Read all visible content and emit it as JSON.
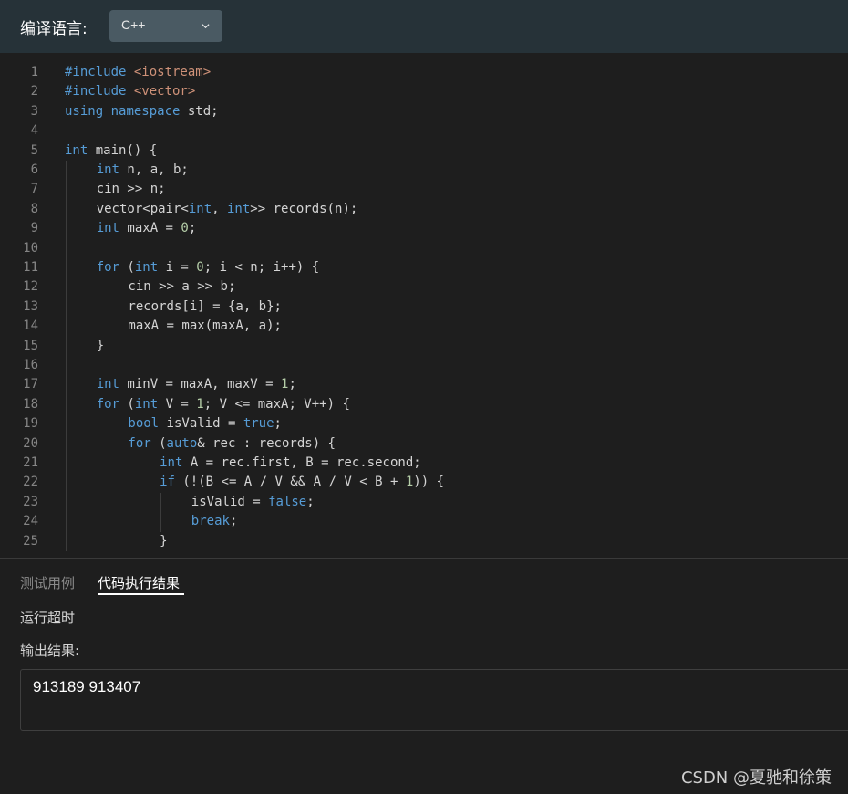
{
  "header": {
    "language_label": "编译语言:",
    "language_value": "C++"
  },
  "code_lines": [
    {
      "n": "1",
      "indent": 0,
      "tokens": [
        [
          "pp",
          "#include "
        ],
        [
          "str",
          "<iostream>"
        ]
      ]
    },
    {
      "n": "2",
      "indent": 0,
      "tokens": [
        [
          "pp",
          "#include "
        ],
        [
          "str",
          "<vector>"
        ]
      ]
    },
    {
      "n": "3",
      "indent": 0,
      "tokens": [
        [
          "kw",
          "using"
        ],
        [
          "",
          " "
        ],
        [
          "kw",
          "namespace"
        ],
        [
          "",
          " std;"
        ]
      ]
    },
    {
      "n": "4",
      "indent": 0,
      "tokens": []
    },
    {
      "n": "5",
      "indent": 0,
      "tokens": [
        [
          "kw",
          "int"
        ],
        [
          "",
          " main() {"
        ]
      ]
    },
    {
      "n": "6",
      "indent": 1,
      "tokens": [
        [
          "kw",
          "int"
        ],
        [
          "",
          " n, a, b;"
        ]
      ]
    },
    {
      "n": "7",
      "indent": 1,
      "tokens": [
        [
          "",
          "cin >> n;"
        ]
      ]
    },
    {
      "n": "8",
      "indent": 1,
      "tokens": [
        [
          "",
          "vector<pair<"
        ],
        [
          "kw",
          "int"
        ],
        [
          "",
          ", "
        ],
        [
          "kw",
          "int"
        ],
        [
          "",
          ">> records(n);"
        ]
      ]
    },
    {
      "n": "9",
      "indent": 1,
      "tokens": [
        [
          "kw",
          "int"
        ],
        [
          "",
          " maxA = "
        ],
        [
          "num",
          "0"
        ],
        [
          "",
          ";"
        ]
      ]
    },
    {
      "n": "10",
      "indent": 1,
      "tokens": []
    },
    {
      "n": "11",
      "indent": 1,
      "tokens": [
        [
          "kw",
          "for"
        ],
        [
          "",
          " ("
        ],
        [
          "kw",
          "int"
        ],
        [
          "",
          " i = "
        ],
        [
          "num",
          "0"
        ],
        [
          "",
          "; i < n; i++) {"
        ]
      ]
    },
    {
      "n": "12",
      "indent": 2,
      "tokens": [
        [
          "",
          "cin >> a >> b;"
        ]
      ]
    },
    {
      "n": "13",
      "indent": 2,
      "tokens": [
        [
          "",
          "records[i] = {a, b};"
        ]
      ]
    },
    {
      "n": "14",
      "indent": 2,
      "tokens": [
        [
          "",
          "maxA = max(maxA, a);"
        ]
      ]
    },
    {
      "n": "15",
      "indent": 1,
      "tokens": [
        [
          "",
          "}"
        ]
      ]
    },
    {
      "n": "16",
      "indent": 1,
      "tokens": []
    },
    {
      "n": "17",
      "indent": 1,
      "tokens": [
        [
          "kw",
          "int"
        ],
        [
          "",
          " minV = maxA, maxV = "
        ],
        [
          "num",
          "1"
        ],
        [
          "",
          ";"
        ]
      ]
    },
    {
      "n": "18",
      "indent": 1,
      "tokens": [
        [
          "kw",
          "for"
        ],
        [
          "",
          " ("
        ],
        [
          "kw",
          "int"
        ],
        [
          "",
          " V = "
        ],
        [
          "num",
          "1"
        ],
        [
          "",
          "; V <= maxA; V++) {"
        ]
      ]
    },
    {
      "n": "19",
      "indent": 2,
      "tokens": [
        [
          "kw",
          "bool"
        ],
        [
          "",
          " isValid = "
        ],
        [
          "kw",
          "true"
        ],
        [
          "",
          ";"
        ]
      ]
    },
    {
      "n": "20",
      "indent": 2,
      "tokens": [
        [
          "kw",
          "for"
        ],
        [
          "",
          " ("
        ],
        [
          "kw",
          "auto"
        ],
        [
          "",
          "& rec : records) {"
        ]
      ]
    },
    {
      "n": "21",
      "indent": 3,
      "tokens": [
        [
          "kw",
          "int"
        ],
        [
          "",
          " A = rec.first, B = rec.second;"
        ]
      ]
    },
    {
      "n": "22",
      "indent": 3,
      "tokens": [
        [
          "kw",
          "if"
        ],
        [
          "",
          " (!(B <= A / V && A / V < B + "
        ],
        [
          "num",
          "1"
        ],
        [
          "",
          ")) {"
        ]
      ]
    },
    {
      "n": "23",
      "indent": 4,
      "tokens": [
        [
          "",
          "isValid = "
        ],
        [
          "kw",
          "false"
        ],
        [
          "",
          ";"
        ]
      ]
    },
    {
      "n": "24",
      "indent": 4,
      "tokens": [
        [
          "kw",
          "break"
        ],
        [
          "",
          ";"
        ]
      ]
    },
    {
      "n": "25",
      "indent": 3,
      "tokens": [
        [
          "",
          "}"
        ]
      ]
    }
  ],
  "tabs": {
    "test_cases": "测试用例",
    "result": "代码执行结果"
  },
  "result": {
    "status": "运行超时",
    "output_label": "输出结果:",
    "output_value": "913189 913407"
  },
  "watermark": "CSDN @夏驰和徐策",
  "colors": {
    "keyword": "#569cd6",
    "number": "#b5cea8",
    "string": "#ce9178",
    "background": "#1e1e1e",
    "header": "#263238"
  }
}
